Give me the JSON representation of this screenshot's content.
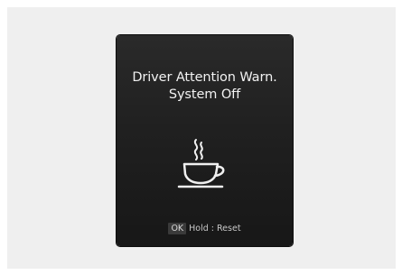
{
  "message": {
    "line1": "Driver Attention Warn.",
    "line2": "System Off"
  },
  "icon": "coffee-cup-icon",
  "footer": {
    "ok_key": "OK",
    "hold_label": "Hold",
    "separator": ":",
    "action_label": "Reset"
  },
  "colors": {
    "display_background": "#222222",
    "text": "#f2f2f2",
    "outer_background": "#efefef"
  }
}
